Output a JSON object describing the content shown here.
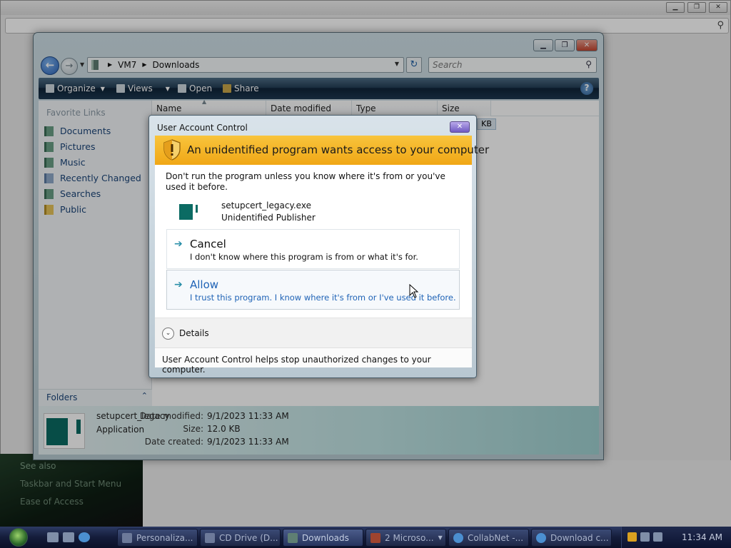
{
  "background": {
    "see_also": "See also",
    "links": [
      "Taskbar and Start Menu",
      "Ease of Access"
    ]
  },
  "explorer": {
    "breadcrumb": [
      "VM7",
      "Downloads"
    ],
    "search_placeholder": "Search",
    "toolbar": {
      "organize": "Organize",
      "views": "Views",
      "open": "Open",
      "share": "Share"
    },
    "favorites_title": "Favorite Links",
    "favorites": [
      "Documents",
      "Pictures",
      "Music",
      "Recently Changed",
      "Searches",
      "Public"
    ],
    "folders_label": "Folders",
    "columns": [
      "Name",
      "Date modified",
      "Type",
      "Size"
    ],
    "size_fragment": "KB",
    "details": {
      "name": "setupcert_legacy",
      "type": "Application",
      "date_modified_label": "Date modified:",
      "date_modified": "9/1/2023 11:33 AM",
      "size_label": "Size:",
      "size": "12.0 KB",
      "date_created_label": "Date created:",
      "date_created": "9/1/2023 11:33 AM"
    }
  },
  "uac": {
    "title": "User Account Control",
    "banner": "An unidentified program wants access to your computer",
    "warning": "Don't run the program unless you know where it's from or you've used it before.",
    "program_name": "setupcert_legacy.exe",
    "publisher": "Unidentified Publisher",
    "cancel_title": "Cancel",
    "cancel_desc": "I don't know where this program is from or what it's for.",
    "allow_title": "Allow",
    "allow_desc": "I trust this program. I know where it's from or I've used it before.",
    "details_label": "Details",
    "footer": "User Account Control helps stop unauthorized changes to your computer."
  },
  "taskbar": {
    "buttons": [
      "Personaliza...",
      "CD Drive (D...",
      "Downloads",
      "2 Microso...",
      "CollabNet -...",
      "Download c..."
    ],
    "clock": "11:34 AM"
  },
  "colors": {
    "banner": "#f0a716",
    "link": "#1b4579",
    "allow_hover": "#1f63b6"
  }
}
